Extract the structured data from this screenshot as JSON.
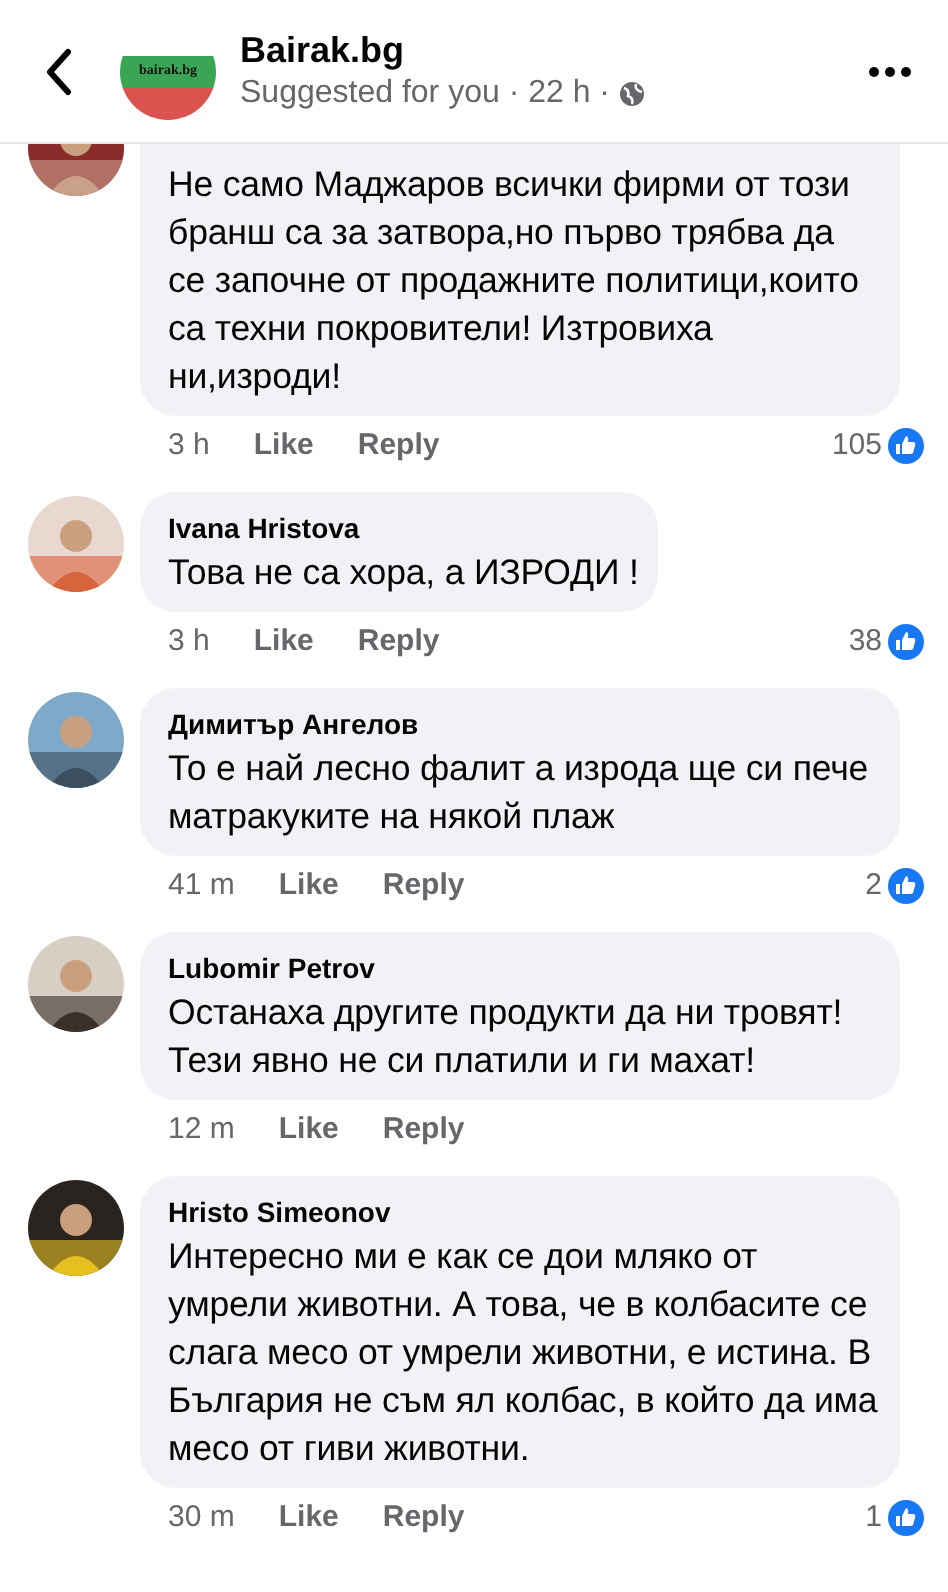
{
  "header": {
    "page_name": "Bairak.bg",
    "logo_text": "bairak.bg",
    "subtitle": "Suggested for you · 22 h ·"
  },
  "comments": [
    {
      "text": "Не само Маджаров всички фирми от този бранш са за затвора,но първо трябва да се започне от продажните политици,които са техни покровители! Изтровиха ни,изроди!",
      "time": "3 h",
      "like": "Like",
      "reply": "Reply",
      "reactions": "105"
    },
    {
      "author": "Ivana Hristova",
      "text": "Това не са хора, а ИЗРОДИ !",
      "time": "3 h",
      "like": "Like",
      "reply": "Reply",
      "reactions": "38"
    },
    {
      "author": "Димитър Ангелов",
      "text": "То е най лесно фалит а изрода ще си пече матракуките на някой плаж",
      "time": "41 m",
      "like": "Like",
      "reply": "Reply",
      "reactions": "2"
    },
    {
      "author": "Lubomir Petrov",
      "text": "Останаха другите продукти да ни тровят! Тези явно не си платили и ги махат!",
      "time": "12 m",
      "like": "Like",
      "reply": "Reply"
    },
    {
      "author": "Hristo Simeonov",
      "text": "Интересно ми е как се дои мляко от умрели животни. А това, че в колбасите се слага месо от умрели животни, е истина. В България не съм ял колбас, в който да има месо от гиви животни.",
      "time": "30 m",
      "like": "Like",
      "reply": "Reply",
      "reactions": "1"
    }
  ]
}
